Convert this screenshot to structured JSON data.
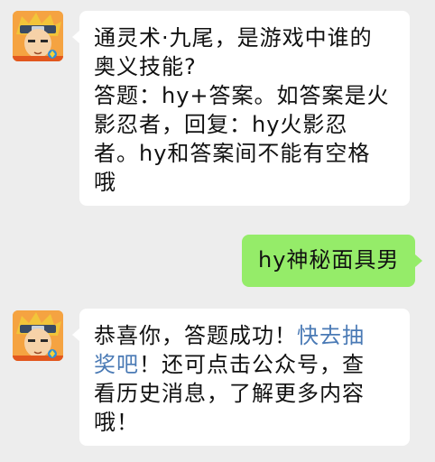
{
  "chat": {
    "messages": [
      {
        "sender": "game_account",
        "avatar_icon": "naruto-game-avatar-icon",
        "lines": [
          "通灵术·九尾，是游戏中谁的",
          "奥义技能?",
          "答题：hy+答案。如答案是火",
          "影忍者，回复：hy火影忍",
          "者。hy和答案间不能有空格",
          "哦"
        ]
      },
      {
        "sender": "me",
        "text": "hy神秘面具男"
      },
      {
        "sender": "game_account",
        "avatar_icon": "naruto-game-avatar-icon",
        "line1_text": "恭喜你，答题成功！",
        "line1_link": "快去抽",
        "line2_link": "奖吧",
        "line2_text": "！还可点击公众号，查",
        "line3": "看历史消息，了解更多内容",
        "line4": "哦！"
      }
    ]
  },
  "colors": {
    "background": "#ededed",
    "incoming_bubble": "#ffffff",
    "outgoing_bubble": "#95ec69",
    "link": "#4a7ab5"
  }
}
